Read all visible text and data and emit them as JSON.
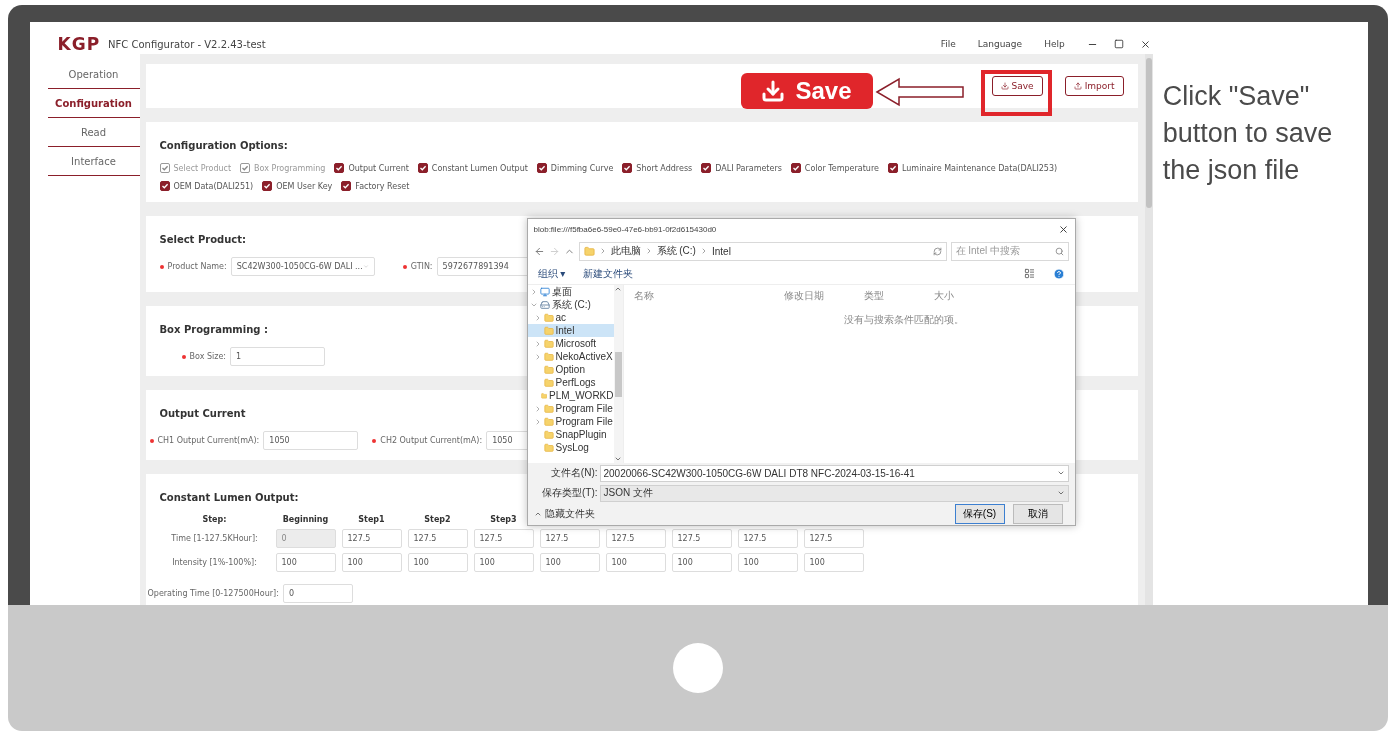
{
  "window": {
    "logo": "KGP",
    "title": "NFC Configurator - V2.2.43-test",
    "menu": [
      "File",
      "Language",
      "Help"
    ]
  },
  "sidebar": {
    "items": [
      {
        "label": "Operation",
        "selected": false
      },
      {
        "label": "Configuration",
        "selected": true
      },
      {
        "label": "Read",
        "selected": false
      },
      {
        "label": "Interface",
        "selected": false
      }
    ]
  },
  "toolbar": {
    "buttons": [
      {
        "label": "Save",
        "kind": "save"
      },
      {
        "label": "Import",
        "kind": "import"
      }
    ]
  },
  "callout": {
    "label": "Save",
    "note": "Click \"Save\" button to save the json file"
  },
  "config_options": {
    "title": "Configuration Options:",
    "options": [
      {
        "label": "Select Product",
        "checked": true,
        "disabled": true
      },
      {
        "label": "Box Programming",
        "checked": true,
        "disabled": true
      },
      {
        "label": "Output Current",
        "checked": true,
        "disabled": false
      },
      {
        "label": "Constant Lumen Output",
        "checked": true,
        "disabled": false
      },
      {
        "label": "Dimming Curve",
        "checked": true,
        "disabled": false
      },
      {
        "label": "Short Address",
        "checked": true,
        "disabled": false
      },
      {
        "label": "DALI Parameters",
        "checked": true,
        "disabled": false
      },
      {
        "label": "Color Temperature",
        "checked": true,
        "disabled": false
      },
      {
        "label": "Luminaire Maintenance Data(DALI253)",
        "checked": true,
        "disabled": false
      },
      {
        "label": "OEM Data(DALI251)",
        "checked": true,
        "disabled": false
      },
      {
        "label": "OEM User Key",
        "checked": true,
        "disabled": false
      },
      {
        "label": "Factory Reset",
        "checked": true,
        "disabled": false
      }
    ]
  },
  "select_product": {
    "title": "Select Product:",
    "fields": [
      {
        "label": "Product Name:",
        "value": "SC42W300-1050CG-6W DALI ...",
        "kind": "select",
        "required": true
      },
      {
        "label": "GTIN:",
        "value": "5972677891394",
        "kind": "input",
        "required": true
      }
    ]
  },
  "box_programming": {
    "title": "Box Programming :",
    "fields": [
      {
        "label": "Box Size:",
        "value": "1",
        "kind": "input",
        "required": true
      }
    ]
  },
  "output_current": {
    "title": "Output Current",
    "fields": [
      {
        "label": "CH1 Output Current(mA):",
        "value": "1050",
        "kind": "input",
        "required": true
      },
      {
        "label": "CH2 Output Current(mA):",
        "value": "1050",
        "kind": "input",
        "required": true
      }
    ]
  },
  "constant_lumen_output": {
    "title": "Constant Lumen Output:",
    "header": [
      "Step:",
      "Beginning",
      "Step1",
      "Step2",
      "Step3"
    ],
    "rows": [
      {
        "label": "Time [1-127.5KHour]:",
        "cells": [
          {
            "value": "0",
            "disabled": true
          },
          {
            "value": "127.5",
            "disabled": false
          },
          {
            "value": "127.5",
            "disabled": false
          },
          {
            "value": "127.5",
            "disabled": false
          },
          {
            "value": "127.5",
            "disabled": false
          },
          {
            "value": "127.5",
            "disabled": false
          },
          {
            "value": "127.5",
            "disabled": false
          },
          {
            "value": "127.5",
            "disabled": false
          },
          {
            "value": "127.5",
            "disabled": false
          }
        ]
      },
      {
        "label": "Intensity [1%-100%]:",
        "cells": [
          {
            "value": "100",
            "disabled": false
          },
          {
            "value": "100",
            "disabled": false
          },
          {
            "value": "100",
            "disabled": false
          },
          {
            "value": "100",
            "disabled": false
          },
          {
            "value": "100",
            "disabled": false
          },
          {
            "value": "100",
            "disabled": false
          },
          {
            "value": "100",
            "disabled": false
          },
          {
            "value": "100",
            "disabled": false
          },
          {
            "value": "100",
            "disabled": false
          }
        ]
      }
    ],
    "operating_time": {
      "label": "Operating Time [0-127500Hour]:",
      "value": "0"
    }
  },
  "save_dialog": {
    "title": "blob:file:///f5fba6e6-59e0-47e6-bb91-0f2d615430d0",
    "path": [
      "此电脑",
      "系统 (C:)",
      "Intel"
    ],
    "search_placeholder": "在 Intel 中搜索",
    "organize": "组织 ▾",
    "new_folder": "新建文件夹",
    "tree": [
      {
        "label": "桌面",
        "kind": "desktop",
        "expandable": true,
        "expanded": false,
        "selected": false
      },
      {
        "label": "系统 (C:)",
        "kind": "drive",
        "expandable": true,
        "expanded": true,
        "selected": false,
        "children": [
          {
            "label": "ac",
            "kind": "folder",
            "expandable": true,
            "expanded": false,
            "selected": false
          },
          {
            "label": "Intel",
            "kind": "folder",
            "expandable": false,
            "expanded": false,
            "selected": true
          },
          {
            "label": "Microsoft",
            "kind": "folder",
            "expandable": true,
            "expanded": false,
            "selected": false
          },
          {
            "label": "NekoActiveX",
            "kind": "folder",
            "expandable": true,
            "expanded": false,
            "selected": false
          },
          {
            "label": "Option",
            "kind": "folder",
            "expandable": false,
            "expanded": false,
            "selected": false
          },
          {
            "label": "PerfLogs",
            "kind": "folder",
            "expandable": false,
            "expanded": false,
            "selected": false
          },
          {
            "label": "PLM_WORKD",
            "kind": "folder",
            "expandable": false,
            "expanded": false,
            "selected": false
          },
          {
            "label": "Program File",
            "kind": "folder",
            "expandable": true,
            "expanded": false,
            "selected": false
          },
          {
            "label": "Program File",
            "kind": "folder",
            "expandable": true,
            "expanded": false,
            "selected": false
          },
          {
            "label": "SnapPlugin",
            "kind": "folder",
            "expandable": false,
            "expanded": false,
            "selected": false
          },
          {
            "label": "SysLog",
            "kind": "folder",
            "expandable": false,
            "expanded": false,
            "selected": false
          }
        ]
      }
    ],
    "columns": [
      "名称",
      "修改日期",
      "类型",
      "大小"
    ],
    "empty_message": "没有与搜索条件匹配的项。",
    "file_name_label": "文件名(N):",
    "file_name": "20020066-SC42W300-1050CG-6W DALI DT8 NFC-2024-03-15-16-41",
    "file_type_label": "保存类型(T):",
    "file_type": "JSON 文件",
    "hide_folders": "隐藏文件夹",
    "buttons": [
      {
        "label": "保存(S)",
        "kind": "primary"
      },
      {
        "label": "取消",
        "kind": "secondary"
      }
    ]
  }
}
